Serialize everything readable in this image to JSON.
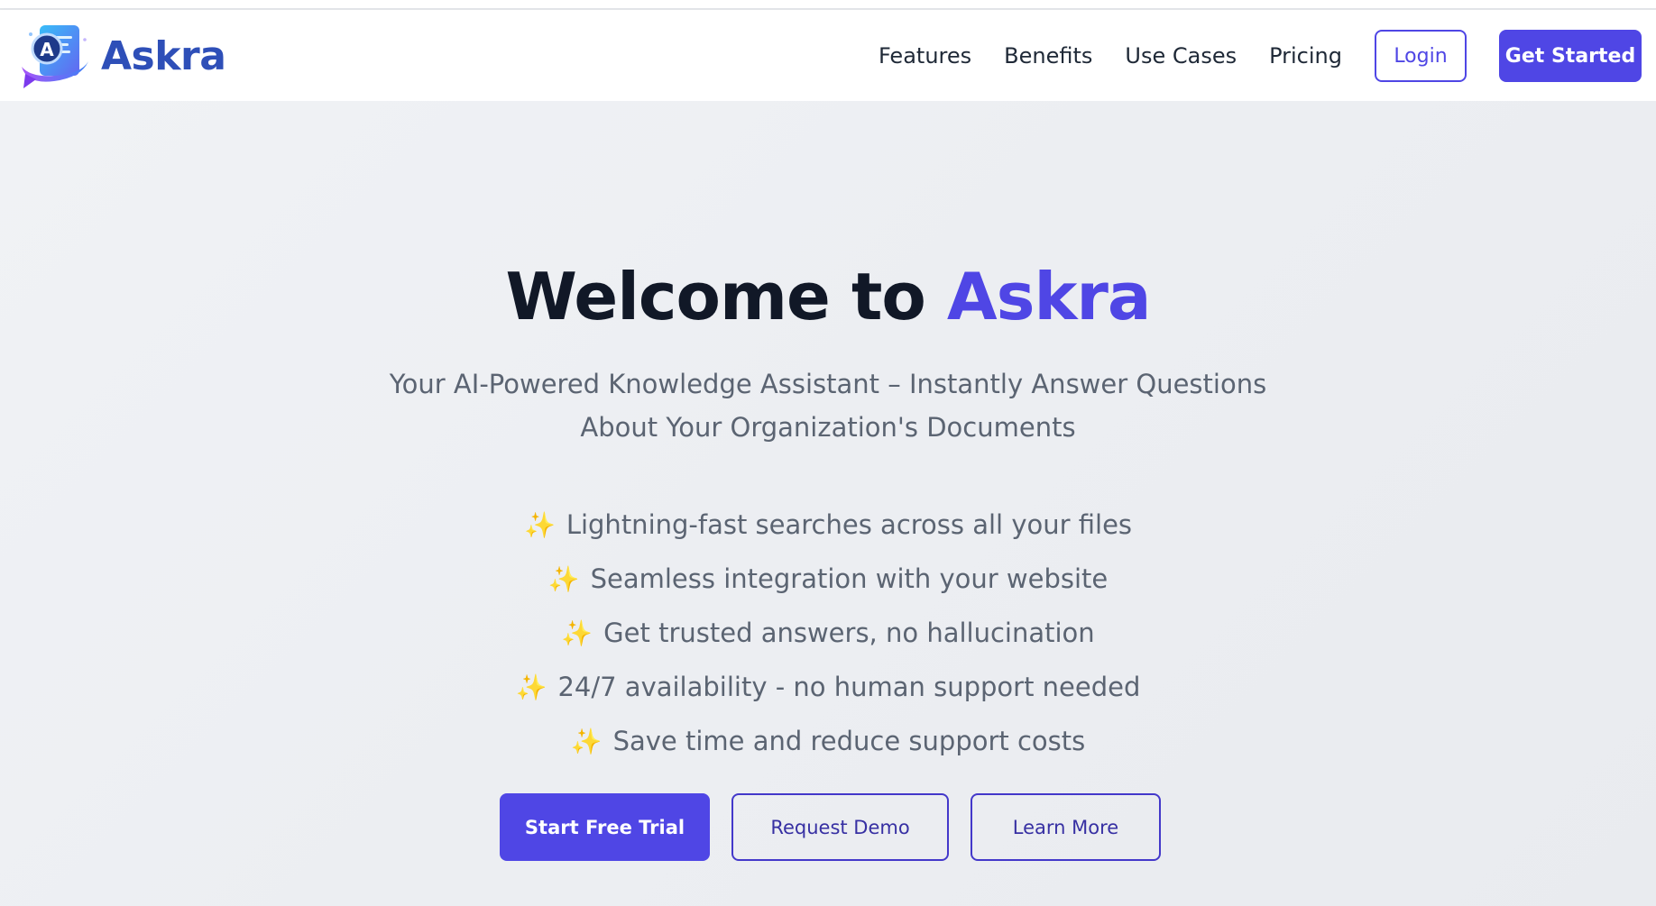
{
  "brand": {
    "name": "Askra",
    "logo_icon": "askra-logo-icon"
  },
  "nav": {
    "links": [
      "Features",
      "Benefits",
      "Use Cases",
      "Pricing"
    ],
    "login_label": "Login",
    "get_started_label": "Get Started"
  },
  "hero": {
    "title_prefix": "Welcome to",
    "title_accent": "Askra",
    "subtitle_line1": "Your AI-Powered Knowledge Assistant – Instantly Answer Questions",
    "subtitle_line2": "About Your Organization's Documents",
    "feature_icon": "sparkles-icon",
    "features": [
      "Lightning-fast searches across all your files",
      "Seamless integration with your website",
      "Get trusted answers, no hallucination",
      "24/7 availability - no human support needed",
      "Save time and reduce support costs"
    ],
    "cta": {
      "primary": "Start Free Trial",
      "demo": "Request Demo",
      "learn": "Learn More"
    }
  },
  "colors": {
    "accent": "#4f46e5",
    "brand_text": "#2e4fb8",
    "heading": "#111827",
    "body_text": "#5b6472",
    "background": "#eef0f4"
  }
}
